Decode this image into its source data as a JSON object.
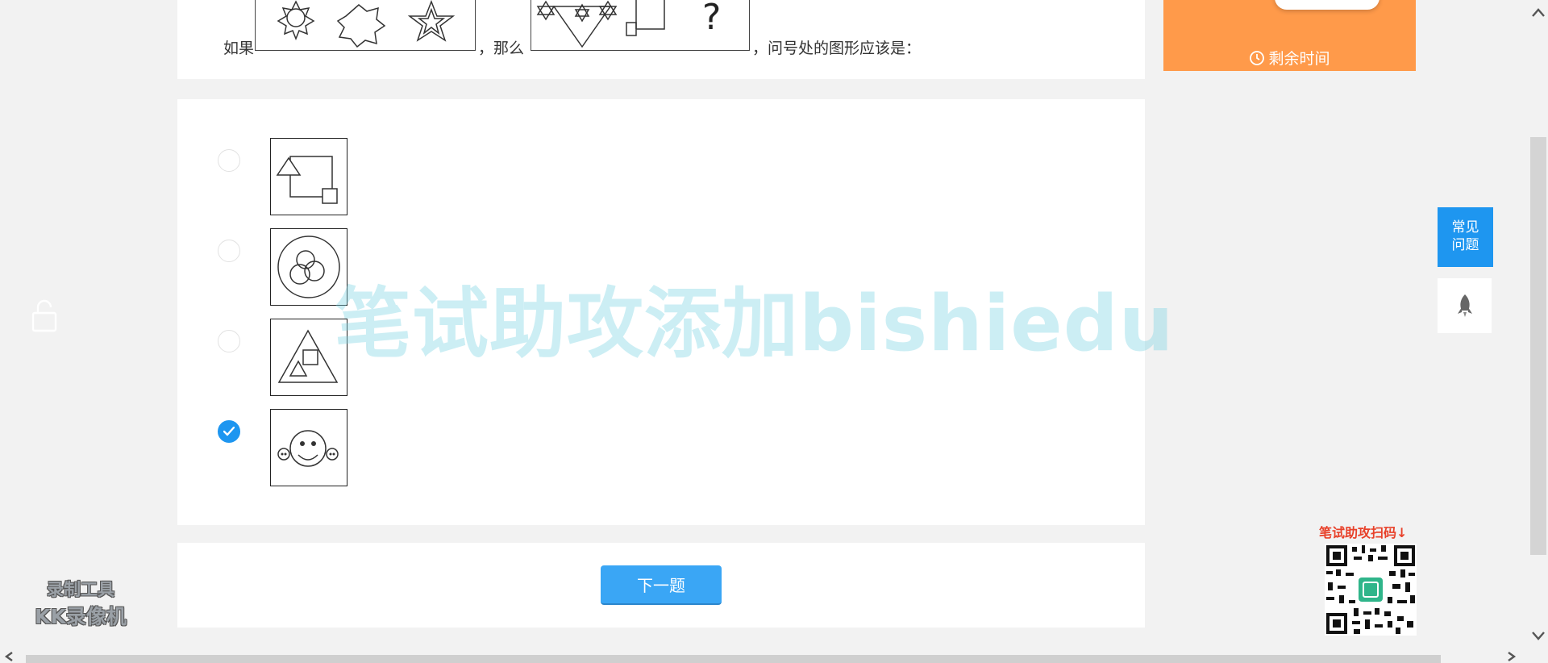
{
  "question": {
    "prefix": "如果",
    "middle": "，那么",
    "suffix": "，问号处的图形应该是："
  },
  "options": [
    {
      "figure": "square-triangle-small-square",
      "selected": false
    },
    {
      "figure": "circle-three-circles",
      "selected": false
    },
    {
      "figure": "triangle-square-small-triangle",
      "selected": false
    },
    {
      "figure": "smiley-face",
      "selected": true
    }
  ],
  "navigation": {
    "next_label": "下一题"
  },
  "timer": {
    "label": "剩余时间"
  },
  "side": {
    "faq_label_line1": "常见",
    "faq_label_line2": "问题"
  },
  "qr": {
    "caption": "笔试助攻扫码↓"
  },
  "overlay": {
    "watermark_text": "笔试助攻添加bishiedu"
  },
  "recorder": {
    "line1": "录制工具",
    "line2": "KK录像机"
  },
  "colors": {
    "accent": "#1e96f0",
    "button": "#3aa6f5",
    "timer_bg": "#ff9a4a",
    "qr_caption": "#e8412a"
  },
  "icons": [
    "clock-icon",
    "lock-icon",
    "rocket-icon",
    "check-icon",
    "scroll-up-icon",
    "scroll-down-icon",
    "scroll-left-icon",
    "scroll-right-icon"
  ]
}
